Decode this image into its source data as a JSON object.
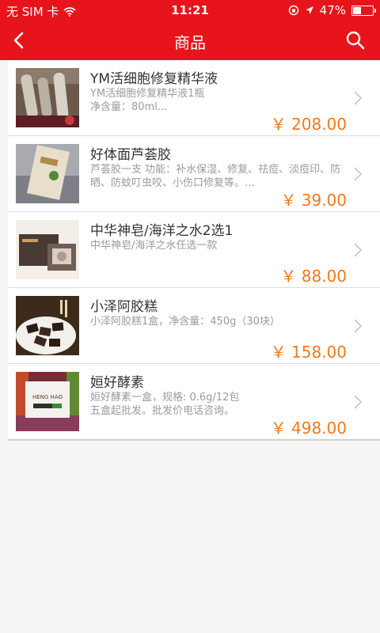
{
  "status": {
    "carrier": "无 SIM 卡",
    "time": "11:21",
    "battery": "47%",
    "battery_level": 0.47
  },
  "nav": {
    "title": "商品",
    "back_icon": "chevron-left-icon",
    "search_icon": "search-icon"
  },
  "products": [
    {
      "name": "YM活细胞修复精华液",
      "desc": "YM活细胞修复精华液1瓶\n净含量：80ml…",
      "price": "￥ 208.00"
    },
    {
      "name": "好体面芦荟胶",
      "desc": "芦荟胶一支  功能：补水保湿、修复、祛痘、淡痘印、防晒、防蚊叮虫咬、小伤口修复等。…",
      "price": "￥ 39.00"
    },
    {
      "name": "中华神皂/海洋之水2选1",
      "desc": "中华神皂/海洋之水任选一款",
      "price": "￥ 88.00"
    },
    {
      "name": "小泽阿胶糕",
      "desc": "小泽阿胶糕1盒，净含量：450g（30块）",
      "price": "￥ 158.00"
    },
    {
      "name": "姮好酵素",
      "desc": "姮好酵素一盒，规格: 0.6g/12包\n五盒起批发。批发价电话咨询。",
      "price": "￥ 498.00",
      "thumb_text": "HENG HAO"
    }
  ],
  "colors": {
    "brand": "#e8141b",
    "price": "#f0791e"
  }
}
